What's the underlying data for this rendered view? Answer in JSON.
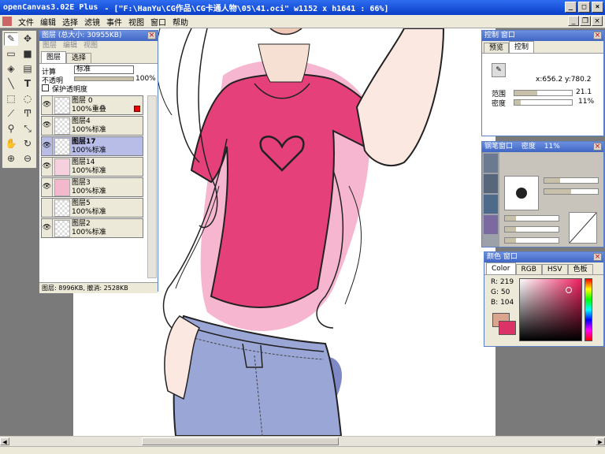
{
  "window": {
    "app": "openCanvas3.02E Plus",
    "doc": "- [\"F:\\HanYu\\CG作品\\CG卡通人物\\05\\41.oci\" w1152 x h1641 : 66%]",
    "min": "_",
    "max": "□",
    "close": "×"
  },
  "menu": [
    "文件",
    "编辑",
    "选择",
    "滤镜",
    "事件",
    "视图",
    "窗口",
    "帮助"
  ],
  "layers_panel": {
    "title": "图层 (总大小: 30955KB)",
    "tabs": [
      "图层",
      "编辑",
      "视图"
    ],
    "subtabs": [
      "图层",
      "选择"
    ],
    "calc_label": "计算",
    "calc_value": "标准",
    "opacity_label": "不透明",
    "opacity_value": "100%",
    "protect_label": "保护透明度",
    "layers": [
      {
        "name": "图层 0",
        "mode": "100%重叠",
        "visible": true
      },
      {
        "name": "图层4",
        "mode": "100%标准",
        "visible": true
      },
      {
        "name": "图层17",
        "mode": "100%标准",
        "visible": true,
        "selected": true
      },
      {
        "name": "图层14",
        "mode": "100%标准",
        "visible": true
      },
      {
        "name": "图层3",
        "mode": "100%标准",
        "visible": true
      },
      {
        "name": "图层5",
        "mode": "100%标准",
        "visible": false
      },
      {
        "name": "图层2",
        "mode": "100%标准",
        "visible": true
      }
    ],
    "footer": "图层: 8996KB, 撤消: 2528KB"
  },
  "control_panel": {
    "title": "控制 窗口",
    "tabs": [
      "预览",
      "控制"
    ],
    "coords": "x:656.2  y:780.2",
    "range_label": "范围",
    "range_value": "21.1",
    "density_label": "密度",
    "density_value": "11%"
  },
  "brush_panel": {
    "title": "钢笔窗口",
    "density_label": "密度",
    "density_value": "11%"
  },
  "color_panel": {
    "title": "颜色 窗口",
    "tabs": [
      "Color",
      "RGB",
      "HSV",
      "色板"
    ],
    "r_label": "R: 219",
    "g_label": "G:  50",
    "b_label": "B: 104",
    "fg_color": "#db3268",
    "bg_color": "#d9a58f"
  },
  "colors": {
    "shirt": "#e5407a",
    "jeans": "#9aa6d6",
    "canvas_bg": "#ffffff",
    "workspace": "#7a7a7a"
  }
}
